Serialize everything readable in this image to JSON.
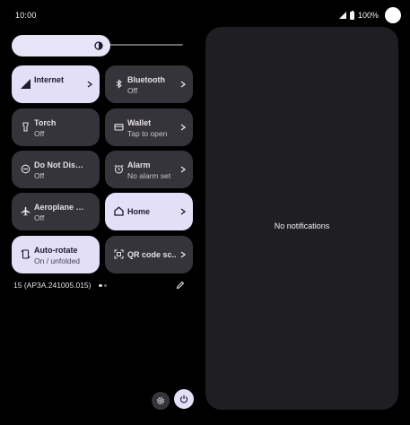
{
  "status_bar": {
    "time": "10:00",
    "battery": "100%"
  },
  "brightness": {
    "level": 0.5
  },
  "tiles": [
    {
      "title": "Internet",
      "subtitle": "",
      "icon": "signal-icon",
      "active": true,
      "chevron": true
    },
    {
      "title": "Bluetooth",
      "subtitle": "Off",
      "icon": "bluetooth-icon",
      "active": false,
      "chevron": true
    },
    {
      "title": "Torch",
      "subtitle": "Off",
      "icon": "torch-icon",
      "active": false,
      "chevron": false
    },
    {
      "title": "Wallet",
      "subtitle": "Tap to open",
      "icon": "wallet-icon",
      "active": false,
      "chevron": true
    },
    {
      "title": "Do Not Disturb",
      "subtitle": "Off",
      "icon": "dnd-icon",
      "active": false,
      "chevron": false
    },
    {
      "title": "Alarm",
      "subtitle": "No alarm set",
      "icon": "alarm-icon",
      "active": false,
      "chevron": true
    },
    {
      "title": "Aeroplane mo..",
      "subtitle": "Off",
      "icon": "airplane-icon",
      "active": false,
      "chevron": false
    },
    {
      "title": "Home",
      "subtitle": "",
      "icon": "home-icon",
      "active": true,
      "chevron": true
    },
    {
      "title": "Auto-rotate",
      "subtitle": "On / unfolded",
      "icon": "rotate-icon",
      "active": true,
      "chevron": false
    },
    {
      "title": "QR code sc..",
      "subtitle": "",
      "icon": "qr-scan-icon",
      "active": false,
      "chevron": true
    }
  ],
  "build_number": "15 (AP3A.241005.015)",
  "page_indicator": {
    "current": 1,
    "total": 2
  },
  "notifications": {
    "empty_text": "No notifications"
  },
  "colors": {
    "background": "#000000",
    "tile_inactive": "#35343a",
    "tile_active": "#e3dff8",
    "panel": "#1f1e22"
  }
}
